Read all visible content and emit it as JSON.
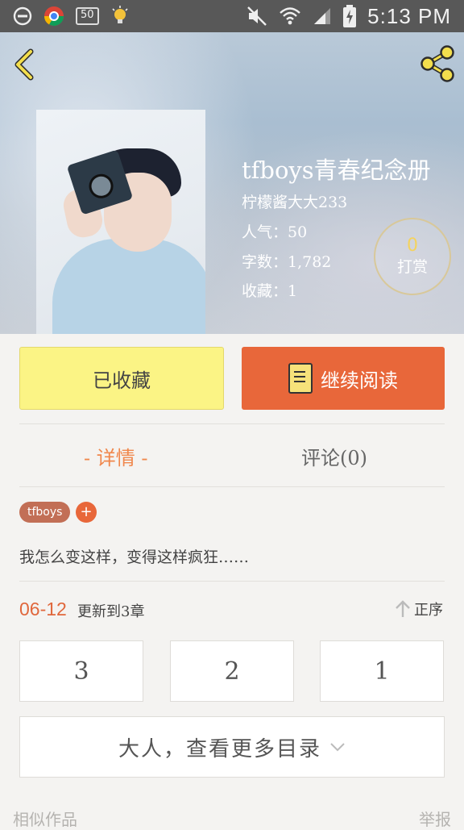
{
  "status_bar": {
    "time": "5:13 PM",
    "badge": "50",
    "icons": [
      "do-not-disturb-icon",
      "chrome-icon",
      "badge-50-icon",
      "lightbulb-icon",
      "mute-icon",
      "wifi-icon",
      "signal-icon",
      "battery-charging-icon"
    ]
  },
  "header": {
    "back_icon": "chevron-left-icon",
    "share_icon": "share-icon"
  },
  "book": {
    "title": "tfboys青春纪念册",
    "author": "柠檬酱大大233",
    "popularity": "人气：50",
    "word_count": "字数：1,782",
    "favorites": "收藏：1",
    "reward_count": "0",
    "reward_label": "打赏"
  },
  "actions": {
    "favorite_label": "已收藏",
    "read_label": "继续阅读"
  },
  "tabs": [
    {
      "label": "- 详情 -",
      "active": true
    },
    {
      "label": "评论(0)",
      "active": false
    }
  ],
  "tags": [
    "tfboys"
  ],
  "tag_add": "+",
  "description": "我怎么变这样，变得这样疯狂……",
  "update": {
    "date": "06-12",
    "text": "更新到3章",
    "sort_label": "正序"
  },
  "chapters": [
    "3",
    "2",
    "1"
  ],
  "more_label": "大人，查看更多目录",
  "footer": {
    "similar": "相似作品",
    "report": "举报"
  },
  "colors": {
    "accent": "#e8673a",
    "tab_active": "#f0874c",
    "fav_button": "#fbf485",
    "tag": "#c26f56",
    "reward_num": "#f4d35e"
  }
}
